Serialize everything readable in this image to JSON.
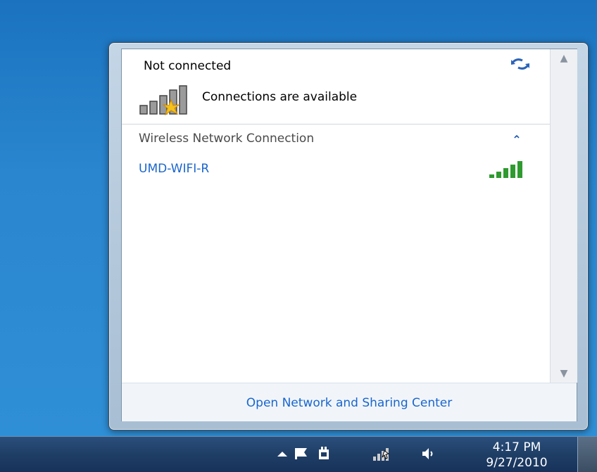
{
  "flyout": {
    "status_title": "Not connected",
    "status_text": "Connections are available",
    "section_title": "Wireless Network Connection",
    "networks": [
      {
        "name": "UMD-WIFI-R",
        "signal_bars": 5
      }
    ],
    "footer_link": "Open Network and Sharing Center",
    "icons": {
      "refresh": "refresh-arrows-icon",
      "status": "signal-bars-star-icon",
      "collapse": "chevron-up-icon",
      "signal": "wifi-signal-icon"
    }
  },
  "taskbar": {
    "time": "4:17 PM",
    "date": "9/27/2010",
    "icons": [
      "show-hidden-icons-icon",
      "action-center-flag-icon",
      "power-icon",
      "network-icon",
      "volume-icon"
    ]
  },
  "colors": {
    "link": "#1a66cc",
    "signal_green": "#2f9a2f",
    "taskbar": "#1f3e66",
    "desktop": "#2a86cf"
  }
}
